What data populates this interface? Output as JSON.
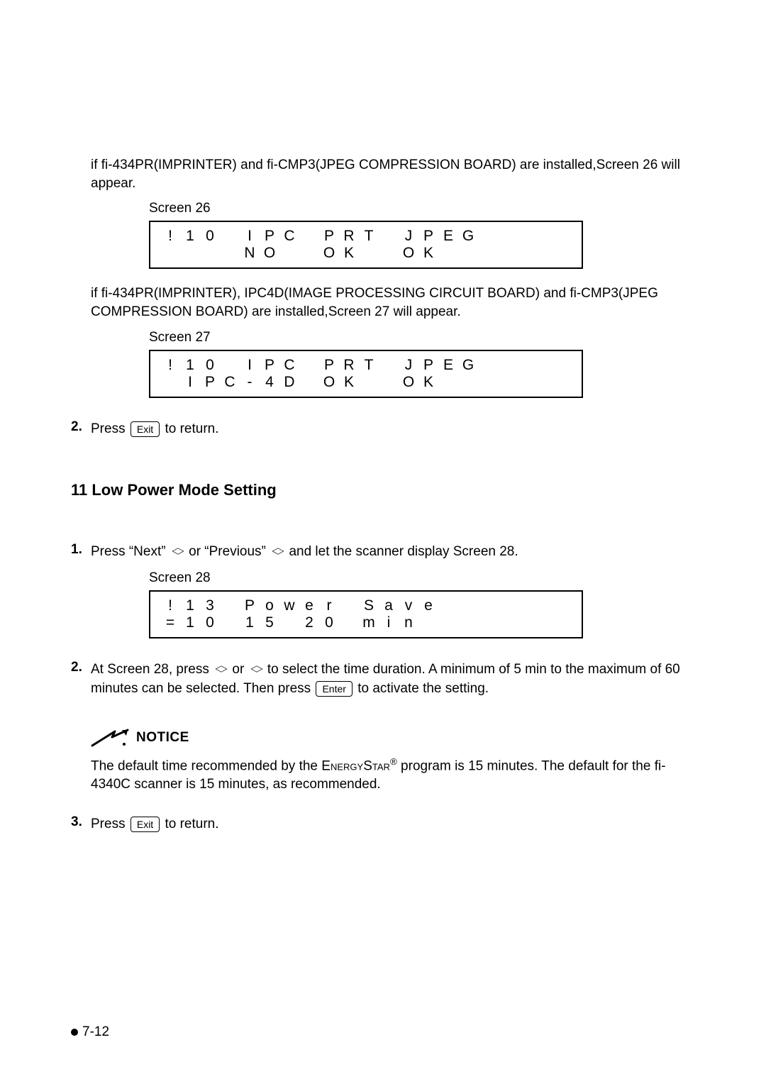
{
  "para1": "if fi-434PR(IMPRINTER) and fi-CMP3(JPEG COMPRESSION BOARD) are installed,Screen 26 will appear.",
  "screen26_label": "Screen 26",
  "screen26": {
    "line1": [
      "!",
      "1",
      "0",
      "",
      "I",
      "P",
      "C",
      "",
      "P",
      "R",
      "T",
      "",
      "J",
      "P",
      "E",
      "G"
    ],
    "line2": [
      "",
      "",
      "",
      "",
      "N",
      "O",
      "",
      "",
      "O",
      "K",
      "",
      "",
      "O",
      "K",
      "",
      ""
    ]
  },
  "para2": "if fi-434PR(IMPRINTER), IPC4D(IMAGE PROCESSING CIRCUIT BOARD) and fi-CMP3(JPEG COMPRESSION BOARD) are installed,Screen 27 will appear.",
  "screen27_label": "Screen 27",
  "screen27": {
    "line1": [
      "!",
      "1",
      "0",
      "",
      "I",
      "P",
      "C",
      "",
      "P",
      "R",
      "T",
      "",
      "J",
      "P",
      "E",
      "G"
    ],
    "line2": [
      "",
      "I",
      "P",
      "C",
      "-",
      "4",
      "D",
      "",
      "O",
      "K",
      "",
      "",
      "O",
      "K",
      "",
      ""
    ]
  },
  "step_a": {
    "num": "2.",
    "pre": "Press ",
    "key": "Exit",
    "post": " to return."
  },
  "section_title": "11  Low Power Mode Setting",
  "step1": {
    "num": "1.",
    "pre": "Press “Next” ",
    "mid": " or “Previous” ",
    "post": " and let the scanner display Screen 28."
  },
  "screen28_label": "Screen 28",
  "screen28": {
    "line1": [
      "!",
      "1",
      "3",
      "",
      "P",
      "o",
      "w",
      "e",
      "r",
      "",
      "S",
      "a",
      "v",
      "e",
      "",
      ""
    ],
    "line2": [
      "=",
      "1",
      "0",
      "",
      "1",
      "5",
      "",
      "2",
      "0",
      "",
      "m",
      "i",
      "n",
      "",
      "",
      ""
    ]
  },
  "step2": {
    "num": "2.",
    "pre": "At Screen 28, press ",
    "mid": " or ",
    "post1": " to select the time duration. A minimum of 5 min to the maximum of 60 minutes can be selected. Then press ",
    "key": "Enter",
    "post2": "  to activate the setting."
  },
  "notice_label": "NOTICE",
  "notice_text_pre": "The default time recommended by the ",
  "notice_brand1": "E",
  "notice_brand2": "nergy",
  "notice_brand3": "S",
  "notice_brand4": "tar",
  "notice_text_post": " program is 15 minutes. The default for the fi-4340C scanner is 15 minutes, as recommended.",
  "step3": {
    "num": "3.",
    "pre": "Press ",
    "key": "Exit",
    "post": " to return."
  },
  "footer": "7-12"
}
